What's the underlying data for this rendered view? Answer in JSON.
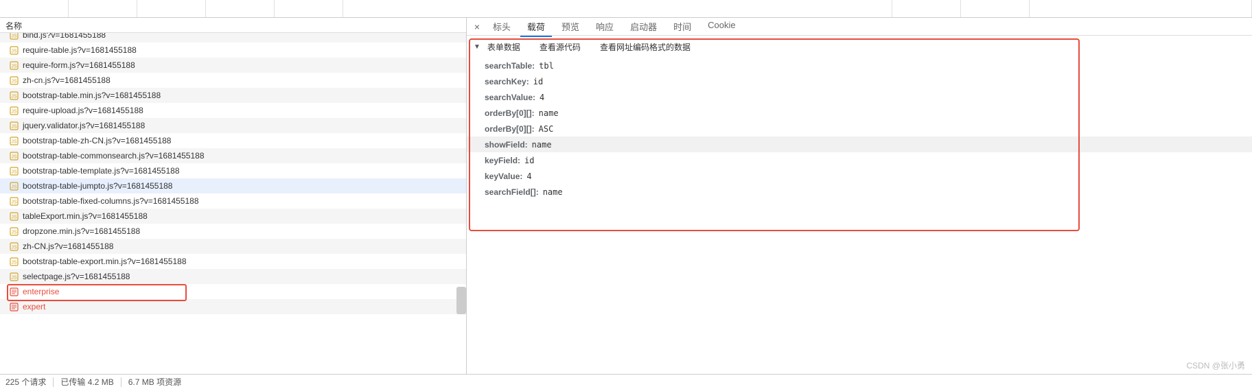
{
  "leftPanel": {
    "header": "名称",
    "files": [
      {
        "name": "bind.js?v=1681455188",
        "type": "js",
        "alt": true,
        "cut": true
      },
      {
        "name": "require-table.js?v=1681455188",
        "type": "js",
        "alt": false
      },
      {
        "name": "require-form.js?v=1681455188",
        "type": "js",
        "alt": true
      },
      {
        "name": "zh-cn.js?v=1681455188",
        "type": "js",
        "alt": false
      },
      {
        "name": "bootstrap-table.min.js?v=1681455188",
        "type": "js",
        "alt": true
      },
      {
        "name": "require-upload.js?v=1681455188",
        "type": "js",
        "alt": false
      },
      {
        "name": "jquery.validator.js?v=1681455188",
        "type": "js",
        "alt": true
      },
      {
        "name": "bootstrap-table-zh-CN.js?v=1681455188",
        "type": "js",
        "alt": false
      },
      {
        "name": "bootstrap-table-commonsearch.js?v=1681455188",
        "type": "js",
        "alt": true
      },
      {
        "name": "bootstrap-table-template.js?v=1681455188",
        "type": "js",
        "alt": false
      },
      {
        "name": "bootstrap-table-jumpto.js?v=1681455188",
        "type": "js",
        "alt": true,
        "selected": true
      },
      {
        "name": "bootstrap-table-fixed-columns.js?v=1681455188",
        "type": "js",
        "alt": false
      },
      {
        "name": "tableExport.min.js?v=1681455188",
        "type": "js",
        "alt": true
      },
      {
        "name": "dropzone.min.js?v=1681455188",
        "type": "js",
        "alt": false
      },
      {
        "name": "zh-CN.js?v=1681455188",
        "type": "js",
        "alt": true
      },
      {
        "name": "bootstrap-table-export.min.js?v=1681455188",
        "type": "js",
        "alt": false
      },
      {
        "name": "selectpage.js?v=1681455188",
        "type": "js",
        "alt": true
      },
      {
        "name": "enterprise",
        "type": "doc",
        "alt": false,
        "red": true,
        "boxed": true
      },
      {
        "name": "expert",
        "type": "doc",
        "alt": true,
        "red": true
      }
    ]
  },
  "rightPanel": {
    "tabs": [
      "标头",
      "载荷",
      "预览",
      "响应",
      "启动器",
      "时间",
      "Cookie"
    ],
    "activeTab": 1,
    "subLinks": [
      "表单数据",
      "查看源代码",
      "查看网址编码格式的数据"
    ],
    "formData": [
      {
        "key": "searchTable:",
        "val": "tbl"
      },
      {
        "key": "searchKey:",
        "val": "id"
      },
      {
        "key": "searchValue:",
        "val": "4"
      },
      {
        "key": "orderBy[0][]:",
        "val": "name"
      },
      {
        "key": "orderBy[0][]:",
        "val": "ASC"
      },
      {
        "key": "showField:",
        "val": "name",
        "hl": true
      },
      {
        "key": "keyField:",
        "val": "id"
      },
      {
        "key": "keyValue:",
        "val": "4"
      },
      {
        "key": "searchField[]:",
        "val": "name"
      }
    ]
  },
  "statusBar": {
    "requests": "225 个请求",
    "transferred": "已传输 4.2 MB",
    "resources": "6.7 MB 项资源"
  },
  "watermark": "CSDN @张小勇"
}
